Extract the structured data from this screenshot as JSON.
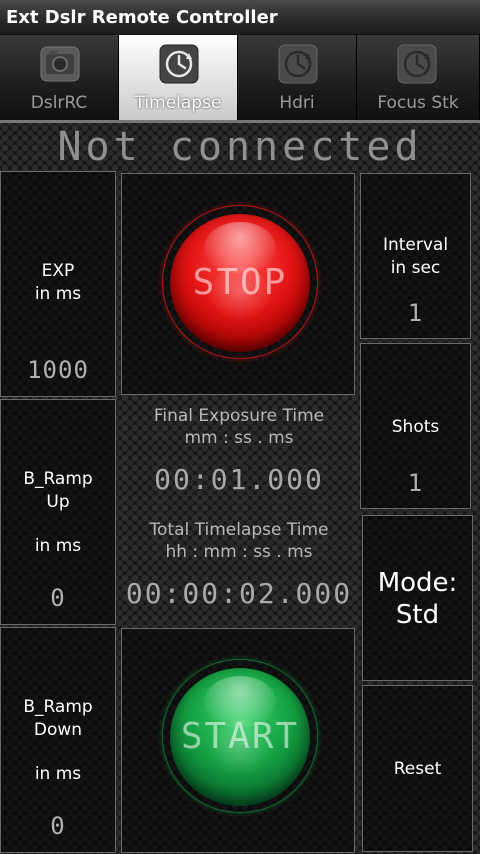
{
  "app": {
    "title": "Ext Dslr Remote Controller"
  },
  "tabs": [
    {
      "label": "DslrRC",
      "icon": "camera-icon",
      "active": false
    },
    {
      "label": "Timelapse",
      "icon": "clock-icon",
      "active": true
    },
    {
      "label": "Hdri",
      "icon": "clock-icon",
      "active": false
    },
    {
      "label": "Focus Stk",
      "icon": "clock-icon",
      "active": false
    }
  ],
  "status": {
    "text": "Not connected"
  },
  "exp": {
    "label_line1": "EXP",
    "label_line2": "in ms",
    "value": "1000"
  },
  "ramp_up": {
    "label_line1": "B_Ramp",
    "label_line2": "Up",
    "label_line3": "in ms",
    "value": "0"
  },
  "ramp_down": {
    "label_line1": "B_Ramp",
    "label_line2": "Down",
    "label_line3": "in ms",
    "value": "0"
  },
  "interval": {
    "label_line1": "Interval",
    "label_line2": "in sec",
    "value": "1"
  },
  "shots": {
    "label": "Shots",
    "value": "1"
  },
  "mode": {
    "label_line1": "Mode:",
    "label_line2": "Std"
  },
  "reset": {
    "label": "Reset"
  },
  "stop_button": {
    "label": "STOP",
    "color": "#e01010"
  },
  "start_button": {
    "label": "START",
    "color": "#12a040"
  },
  "final_exposure": {
    "title": "Final Exposure Time",
    "format": "mm : ss . ms",
    "value": "00:01.000"
  },
  "total_timelapse": {
    "title": "Total Timelapse Time",
    "format": "hh : mm : ss . ms",
    "value": "00:00:02.000"
  }
}
